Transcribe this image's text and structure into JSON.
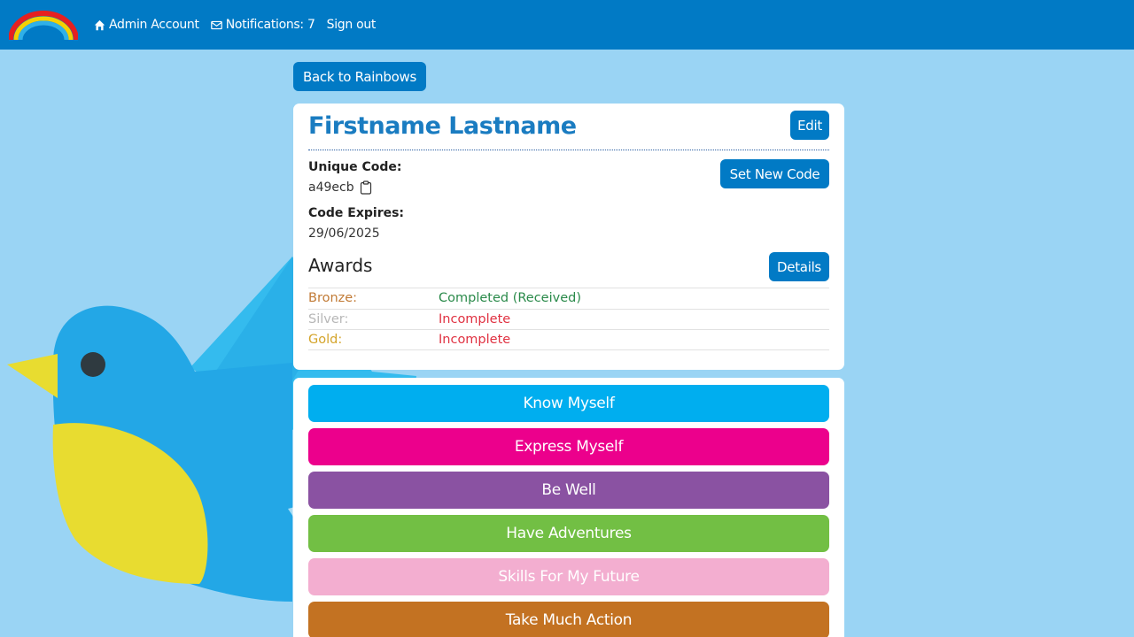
{
  "nav": {
    "admin_label": "Admin Account",
    "notifications_label": "Notifications: 7",
    "signout_label": "Sign out"
  },
  "back_button": "Back to Rainbows",
  "profile": {
    "name": "Firstname Lastname",
    "edit_label": "Edit",
    "unique_code_label": "Unique Code:",
    "unique_code": "a49ecb",
    "set_code_label": "Set New Code",
    "code_expires_label": "Code Expires:",
    "code_expires": "29/06/2025"
  },
  "awards": {
    "title": "Awards",
    "details_label": "Details",
    "rows": [
      {
        "name": "Bronze:",
        "status": "Completed (Received)",
        "name_color": "#c17a35",
        "status_color": "#2a8a4a"
      },
      {
        "name": "Silver:",
        "status": "Incomplete",
        "name_color": "#b7b7b7",
        "status_color": "#e03242"
      },
      {
        "name": "Gold:",
        "status": "Incomplete",
        "name_color": "#d4a42a",
        "status_color": "#e03242"
      }
    ]
  },
  "themes": [
    {
      "label": "Know Myself",
      "color": "#00aeef",
      "text_color": "#ffffff"
    },
    {
      "label": "Express Myself",
      "color": "#ec008c",
      "text_color": "#ffffff"
    },
    {
      "label": "Be Well",
      "color": "#8a52a2",
      "text_color": "#ffffff"
    },
    {
      "label": "Have Adventures",
      "color": "#72bf44",
      "text_color": "#ffffff"
    },
    {
      "label": "Skills For My Future",
      "color": "#f3aed0",
      "text_color": "#ffffff"
    },
    {
      "label": "Take Much Action",
      "color": "#c37222",
      "text_color": "#ffffff"
    }
  ],
  "colors": {
    "brand": "#017ac5",
    "background": "#9ad4f4"
  }
}
